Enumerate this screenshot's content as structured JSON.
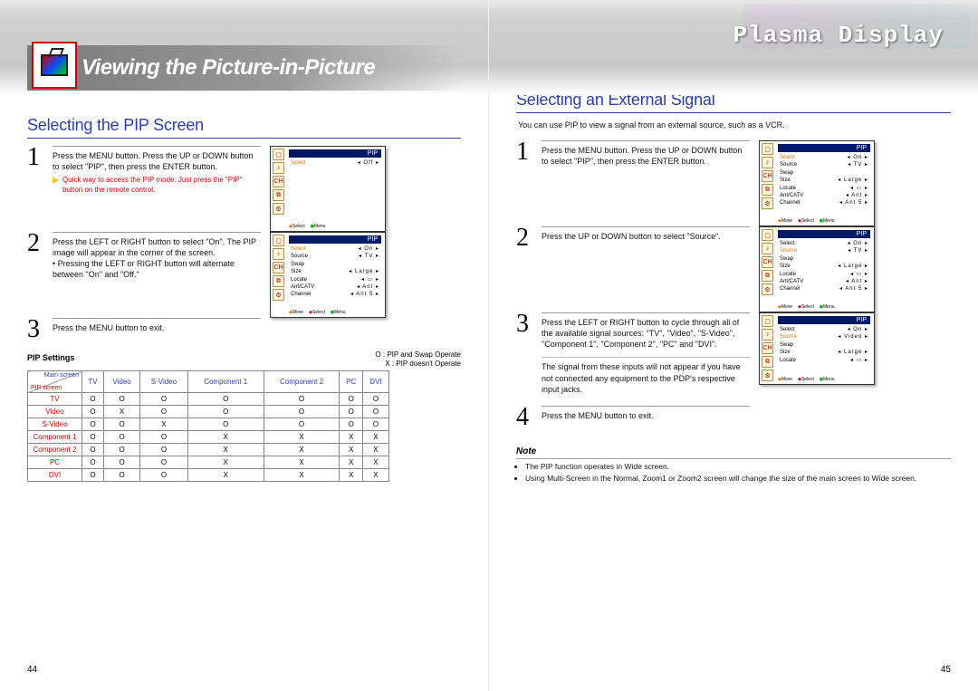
{
  "brand": "Plasma Display",
  "page_title": "Viewing the Picture-in-Picture",
  "left": {
    "section_title": "Selecting the PIP Screen",
    "step1_text": "Press the MENU button. Press the UP or DOWN button to select \"PIP\", then press the ENTER button.",
    "step1_tip": "Quick way to access the PIP mode: Just press the \"PIP\" button on the remote control.",
    "step2_text": "Press the LEFT or RIGHT button to select \"On\". The PIP image will appear in the corner of the screen.",
    "step2_bullet": "Pressing the LEFT or RIGHT button will alternate between \"On\" and \"Off.\"",
    "step3_text": "Press the MENU button to exit.",
    "settings_heading": "PIP Settings",
    "legend_o": "O  :  PIP and Swap Operate",
    "legend_x": "X  :  PIP doesn't Operate",
    "diag_main": "Main screen",
    "diag_pip": "PIP screen",
    "cols": [
      "TV",
      "Video",
      "S-Video",
      "Component 1",
      "Component 2",
      "PC",
      "DVI"
    ],
    "rows": [
      {
        "name": "TV",
        "cells": [
          "O",
          "O",
          "O",
          "O",
          "O",
          "O",
          "O"
        ]
      },
      {
        "name": "Video",
        "cells": [
          "O",
          "X",
          "O",
          "O",
          "O",
          "O",
          "O"
        ]
      },
      {
        "name": "S-Video",
        "cells": [
          "O",
          "O",
          "X",
          "O",
          "O",
          "O",
          "O"
        ]
      },
      {
        "name": "Component 1",
        "cells": [
          "O",
          "O",
          "O",
          "X",
          "X",
          "X",
          "X"
        ]
      },
      {
        "name": "Component 2",
        "cells": [
          "O",
          "O",
          "O",
          "X",
          "X",
          "X",
          "X"
        ]
      },
      {
        "name": "PC",
        "cells": [
          "O",
          "O",
          "O",
          "X",
          "X",
          "X",
          "X"
        ]
      },
      {
        "name": "DVI",
        "cells": [
          "O",
          "O",
          "O",
          "X",
          "X",
          "X",
          "X"
        ]
      }
    ],
    "osd1": {
      "title": "PIP",
      "row1_label": "Select",
      "row1_val": "Off",
      "footer_select": "Select",
      "footer_menu": "Menu"
    },
    "osd2": {
      "title": "PIP",
      "rows": [
        [
          "Select",
          "On"
        ],
        [
          "Source",
          "TV"
        ],
        [
          "Swap",
          ""
        ],
        [
          "Size",
          "Large"
        ],
        [
          "Locate",
          "▭"
        ],
        [
          "Ant/CATV",
          "Ant"
        ],
        [
          "Channel",
          "Ant  5"
        ]
      ],
      "footer_move": "Move",
      "footer_select": "Select",
      "footer_menu": "Menu"
    },
    "page_num": "44"
  },
  "right": {
    "section_title": "Selecting an External Signal",
    "intro": "You can use PIP to view a signal from an external source, such as a VCR.",
    "step1_text": "Press the MENU button. Press the UP or DOWN button to select \"PIP\", then press the ENTER button.",
    "step2_text": "Press the UP or DOWN button to select \"Source\".",
    "step3_text": "Press the LEFT or RIGHT button to cycle through all of the available signal sources: \"TV\", \"Video\", \"S-Video\", \"Component 1\", \"Component 2\", \"PC\" and \"DVI\".",
    "step3_sub": "The signal from these inputs will not appear if you have not connected any equipment to the PDP's respective input jacks.",
    "step4_text": "Press the MENU button to exit.",
    "note_heading": "Note",
    "note1": "The PIP function operates in Wide screen.",
    "note2": "Using Multi-Screen in the Normal, Zoom1 or Zoom2 screen will change the size of the main screen to Wide screen.",
    "osd1": {
      "title": "PIP",
      "rows": [
        [
          "Select",
          "On"
        ],
        [
          "Source",
          "TV"
        ],
        [
          "Swap",
          ""
        ],
        [
          "Size",
          "Large"
        ],
        [
          "Locate",
          "▭"
        ],
        [
          "Ant/CATV",
          "Ant"
        ],
        [
          "Channel",
          "Ant  5"
        ]
      ],
      "hl": 0,
      "footer_move": "Move",
      "footer_select": "Select",
      "footer_menu": "Menu"
    },
    "osd2": {
      "title": "PIP",
      "rows": [
        [
          "Select",
          "On"
        ],
        [
          "Source",
          "TV"
        ],
        [
          "Swap",
          ""
        ],
        [
          "Size",
          "Large"
        ],
        [
          "Locate",
          "▭"
        ],
        [
          "Ant/CATV",
          "Ant"
        ],
        [
          "Channel",
          "Ant  5"
        ]
      ],
      "hl": 1,
      "footer_move": "Move",
      "footer_select": "Select",
      "footer_menu": "Menu"
    },
    "osd3": {
      "title": "PIP",
      "rows": [
        [
          "Select",
          "On"
        ],
        [
          "Source",
          "Video"
        ],
        [
          "Swap",
          ""
        ],
        [
          "Size",
          "Large"
        ],
        [
          "Locate",
          "▭"
        ]
      ],
      "hl": 1,
      "footer_move": "Move",
      "footer_select": "Select",
      "footer_menu": "Menu"
    },
    "page_num": "45"
  }
}
